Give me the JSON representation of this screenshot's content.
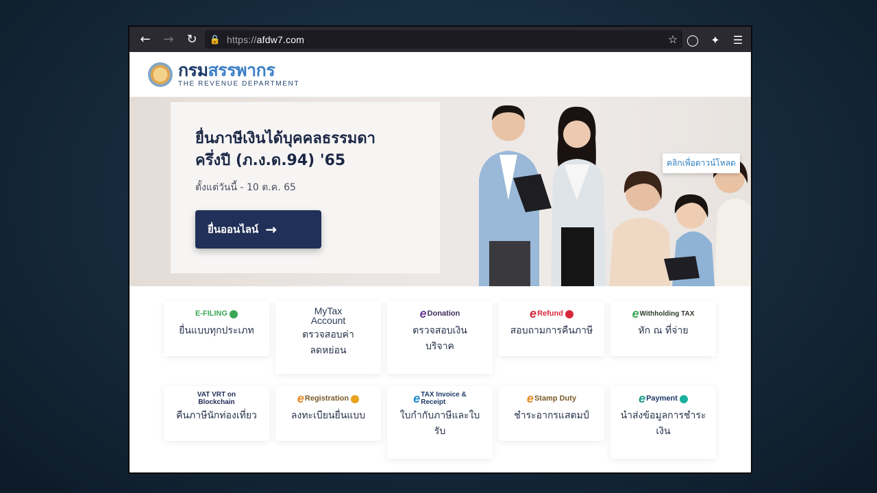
{
  "browser": {
    "url_prefix": "https://",
    "url_host": "afdw7.com"
  },
  "site": {
    "brand_th_1": "กรม",
    "brand_th_2": "สรรพากร",
    "brand_en": "THE REVENUE DEPARTMENT"
  },
  "hero": {
    "title_line1": "ยื่นภาษีเงินได้บุคคลธรรมดา",
    "title_line2": "ครึ่งปี (ภ.ง.ด.94) '65",
    "subtitle": "ตั้งแต่วันนี้ - 10 ต.ค. 65",
    "cta": "ยื่นออนไลน์",
    "download_tag": "คลิกเพื่อดาวน์โหลด"
  },
  "services": [
    {
      "logo": "E-FILING",
      "label": "ยื่นแบบทุกประเภท"
    },
    {
      "logo_l1": "MyTax",
      "logo_l2": "Account",
      "label_l1": "ตรวจสอบค่า",
      "label_l2": "ลดหย่อน"
    },
    {
      "logo": "Donation",
      "label_l1": "ตรวจสอบเงิน",
      "label_l2": "บริจาค"
    },
    {
      "logo": "Refund",
      "label": "สอบถามการคืนภาษี"
    },
    {
      "logo": "Withholding TAX",
      "label": "หัก ณ ที่จ่าย"
    },
    {
      "logo_l1": "VAT VRT on",
      "logo_l2": "Blockchain",
      "label": "คืนภาษีนักท่องเที่ยว"
    },
    {
      "logo": "Registration",
      "label": "ลงทะเบียนยื่นแบบ"
    },
    {
      "logo_l1": "TAX Invoice &",
      "logo_l2": "Receipt",
      "label_l1": "ใบกำกับภาษีและใบ",
      "label_l2": "รับ"
    },
    {
      "logo": "Stamp Duty",
      "label": "ชำระอากรแสตมป์"
    },
    {
      "logo": "Payment",
      "label_l1": "นำส่งข้อมูลการชำระ",
      "label_l2": "เงิน"
    }
  ],
  "colors": {
    "navy": "#213058",
    "brand_blue": "#3c7fc5",
    "efiling_green": "#3aa855",
    "edonation_purple": "#6a3d9a",
    "erefund_red": "#d6283a",
    "eregistration_orange": "#e8881e"
  }
}
